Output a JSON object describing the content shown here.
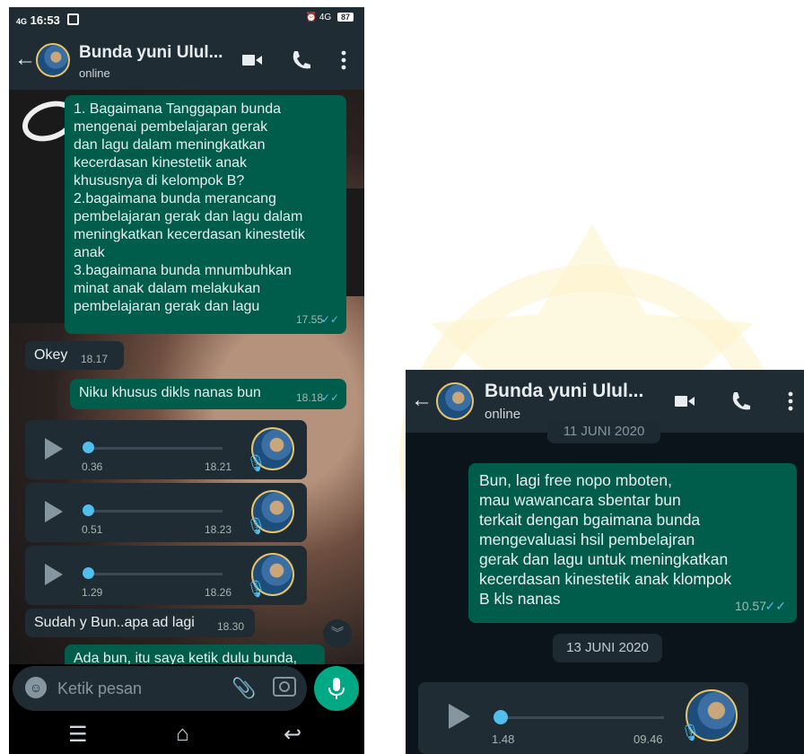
{
  "left_phone": {
    "status": {
      "signal": "4G",
      "time": "16:53",
      "alarm_network": "⏰ 4G",
      "battery": "87"
    },
    "header": {
      "contact_name": "Bunda yuni Ulul...",
      "status": "online"
    },
    "messages": [
      {
        "lines": [
          "1. Bagaimana Tanggapan bunda",
          "mengenai pembelajaran gerak",
          "dan lagu dalam meningkatkan",
          "kecerdasan kinestetik anak",
          "khususnya di kelompok B?",
          "2.bagaimana bunda merancang",
          "pembelajaran gerak dan lagu dalam",
          "meningkatkan kecerdasan kinestetik",
          "anak",
          "3.bagaimana bunda mnumbuhkan",
          "minat anak dalam melakukan",
          "pembelajaran gerak dan lagu"
        ],
        "time": "17.55"
      },
      {
        "text": "Okey",
        "time": "18.17"
      },
      {
        "text": "Niku khusus dikls nanas bun",
        "time": "18.18"
      },
      {
        "text": "Sudah y Bun..apa ad lagi",
        "time": "18.30"
      },
      {
        "text": "Ada bun, itu saya ketik dulu bunda,"
      }
    ],
    "voice_notes": [
      {
        "duration": "0.36",
        "time": "18.21"
      },
      {
        "duration": "0.51",
        "time": "18.23"
      },
      {
        "duration": "1.29",
        "time": "18.26"
      }
    ],
    "input": {
      "placeholder": "Ketik pesan"
    }
  },
  "right_phone": {
    "header": {
      "contact_name": "Bunda yuni Ulul...",
      "status": "online"
    },
    "date_top": "11 JUNI 2020",
    "message": {
      "lines": [
        "Bun,  lagi free nopo mboten,",
        "mau wawancara  sbentar bun",
        "terkait dengan bgaimana bunda",
        "mengevaluasi hsil pembelajran",
        "gerak dan lagu untuk meningkatkan",
        "kecerdasan kinestetik anak klompok",
        "B kls nanas"
      ],
      "time": "10.57"
    },
    "date_chip": "13 JUNI 2020",
    "voice_note": {
      "duration": "1.48",
      "time": "09.46"
    }
  },
  "icons": {
    "back": "arrow-left-icon",
    "video": "video-call-icon",
    "call": "phone-icon",
    "menu": "more-vert-icon",
    "ticks": "double-check-icon"
  },
  "colors": {
    "header_bg": "#1f2c34",
    "outgoing_bubble": "#005c4b",
    "incoming_bubble": "#202c33",
    "accent": "#00a884",
    "read_ticks": "#53bdeb"
  }
}
